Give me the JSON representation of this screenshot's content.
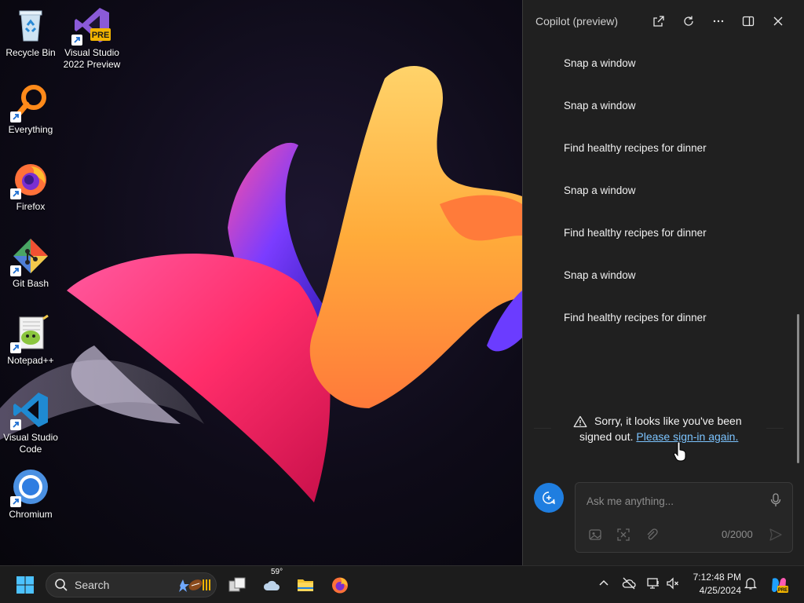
{
  "desktop": {
    "icons": [
      {
        "label": "Recycle Bin",
        "icon": "recycle-bin-icon"
      },
      {
        "label": "Visual Studio 2022 Preview",
        "icon": "visual-studio-preview-icon",
        "badge": "PRE"
      },
      {
        "label": "Everything",
        "icon": "everything-search-icon"
      },
      {
        "label": "Firefox",
        "icon": "firefox-icon"
      },
      {
        "label": "Git Bash",
        "icon": "git-bash-icon"
      },
      {
        "label": "Notepad++",
        "icon": "notepad-plus-plus-icon"
      },
      {
        "label": "Visual Studio Code",
        "icon": "vscode-icon"
      },
      {
        "label": "Chromium",
        "icon": "chromium-icon"
      }
    ]
  },
  "copilot": {
    "title": "Copilot (preview)",
    "suggestions": [
      "Snap a window",
      "Snap a window",
      "Find healthy recipes for dinner",
      "Snap a window",
      "Find healthy recipes for dinner",
      "Snap a window",
      "Find healthy recipes for dinner"
    ],
    "notice": {
      "text1": "Sorry, it looks like you've been",
      "text2": "signed out.",
      "link": "Please sign-in again."
    },
    "input": {
      "placeholder": "Ask me anything...",
      "counter": "0/2000"
    }
  },
  "taskbar": {
    "search_label": "Search",
    "weather_temp": "59°",
    "time": "7:12:48 PM",
    "date": "4/25/2024"
  },
  "colors": {
    "accent": "#1f7ee0",
    "link": "#7cc4ff",
    "pane_bg": "#202020"
  }
}
